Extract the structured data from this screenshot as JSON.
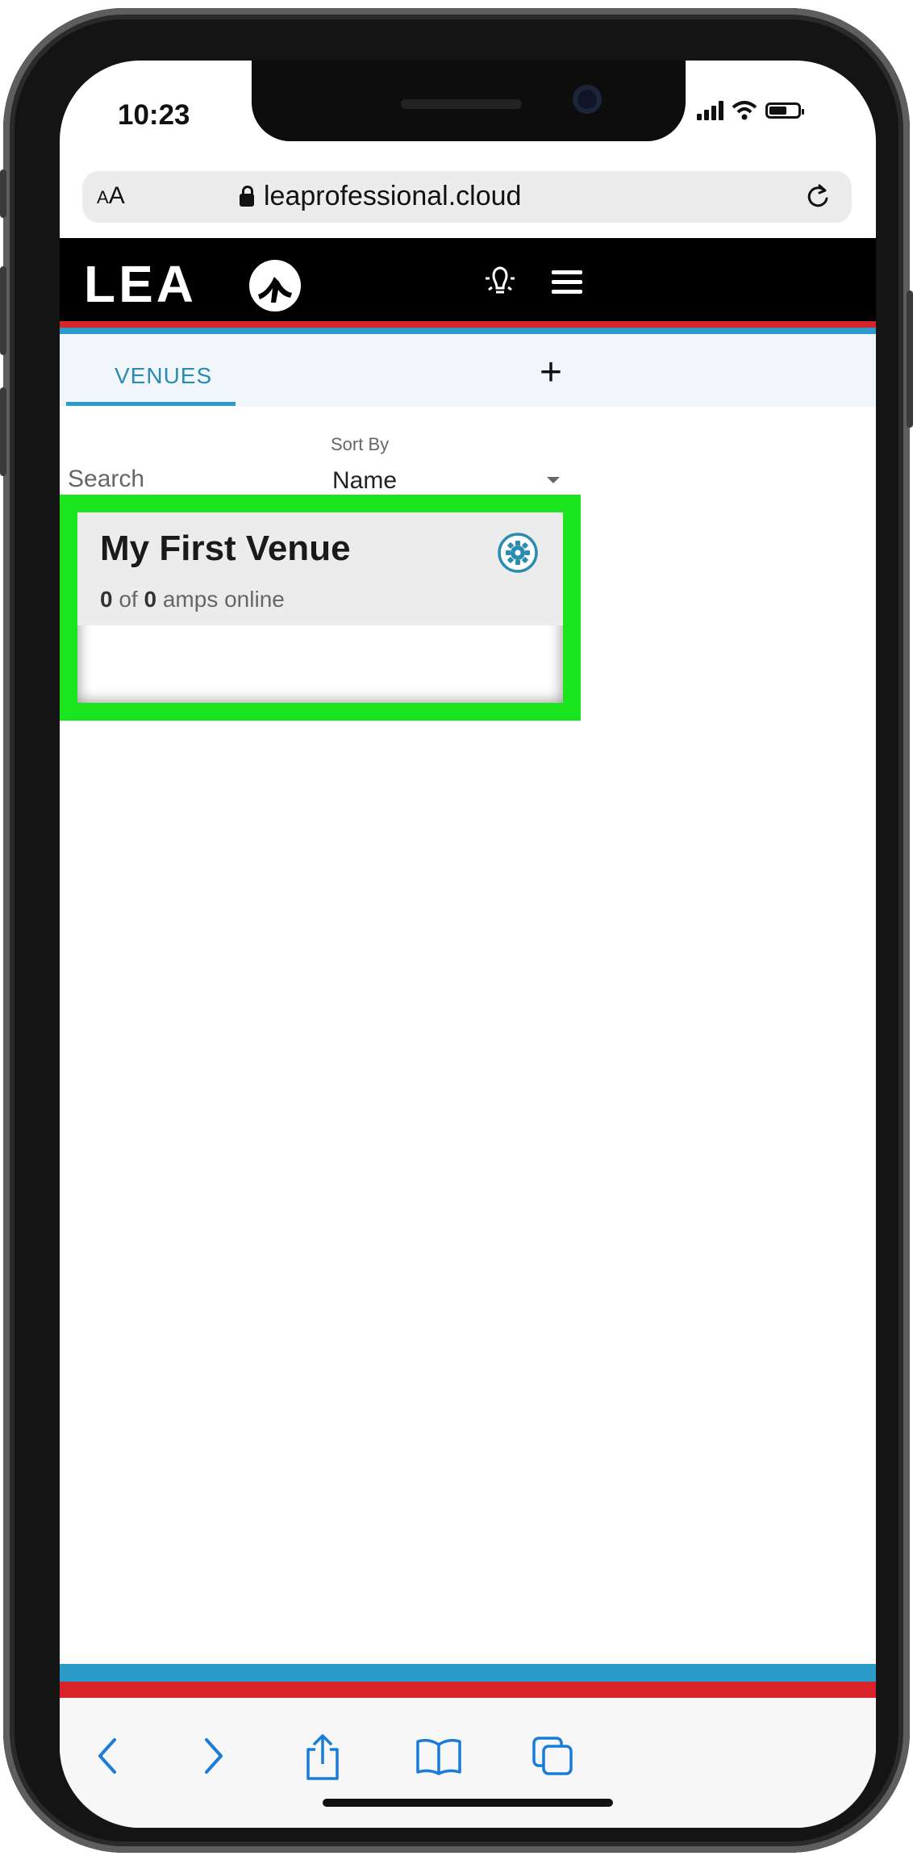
{
  "status_bar": {
    "time": "10:23"
  },
  "browser": {
    "text_size_label_small": "A",
    "text_size_label_large": "A",
    "url": "leaprofessional.cloud"
  },
  "app": {
    "logo_text": "LEA",
    "tabs": [
      {
        "label": "VENUES",
        "active": true
      }
    ],
    "add_label": "+"
  },
  "filters": {
    "search_placeholder": "Search",
    "sort_label": "Sort By",
    "sort_value": "Name"
  },
  "venue_card": {
    "name": "My First Venue",
    "online_count": "0",
    "of_text": "of",
    "total_count": "0",
    "suffix_text": "amps online"
  },
  "colors": {
    "accent_blue": "#2b9cc9",
    "accent_red": "#d8232a",
    "highlight_green": "#1ae51f",
    "header_black": "#000000"
  },
  "icons": {
    "lock": "lock-icon",
    "reload": "reload-icon",
    "bulb": "lightbulb-icon",
    "menu": "hamburger-menu-icon",
    "gear": "gear-icon",
    "back": "back-chevron-icon",
    "forward": "forward-chevron-icon",
    "share": "share-icon",
    "bookmarks": "book-icon",
    "tabs": "tabs-icon"
  }
}
